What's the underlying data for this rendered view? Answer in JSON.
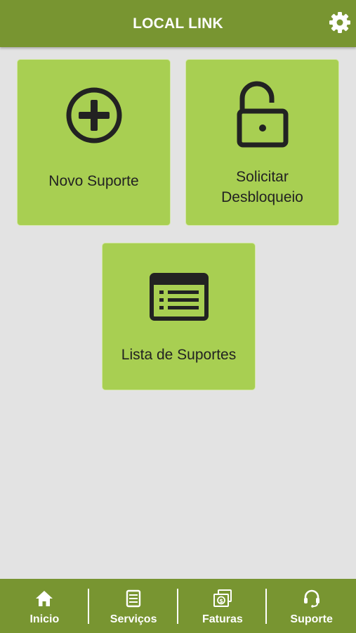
{
  "header": {
    "title": "LOCAL LINK",
    "settings_icon": "gear-icon"
  },
  "tiles": [
    {
      "label": "Novo Suporte",
      "icon": "plus-circle-icon"
    },
    {
      "label": "Solicitar Desbloqueio",
      "icon": "unlock-icon"
    },
    {
      "label": "Lista de Suportes",
      "icon": "list-icon"
    }
  ],
  "nav": [
    {
      "label": "Inicio",
      "icon": "home-icon"
    },
    {
      "label": "Serviços",
      "icon": "document-icon"
    },
    {
      "label": "Faturas",
      "icon": "money-icon"
    },
    {
      "label": "Suporte",
      "icon": "headset-icon"
    }
  ],
  "colors": {
    "primary": "#789531",
    "tile": "#a8cf52",
    "background": "#e3e3e3"
  }
}
